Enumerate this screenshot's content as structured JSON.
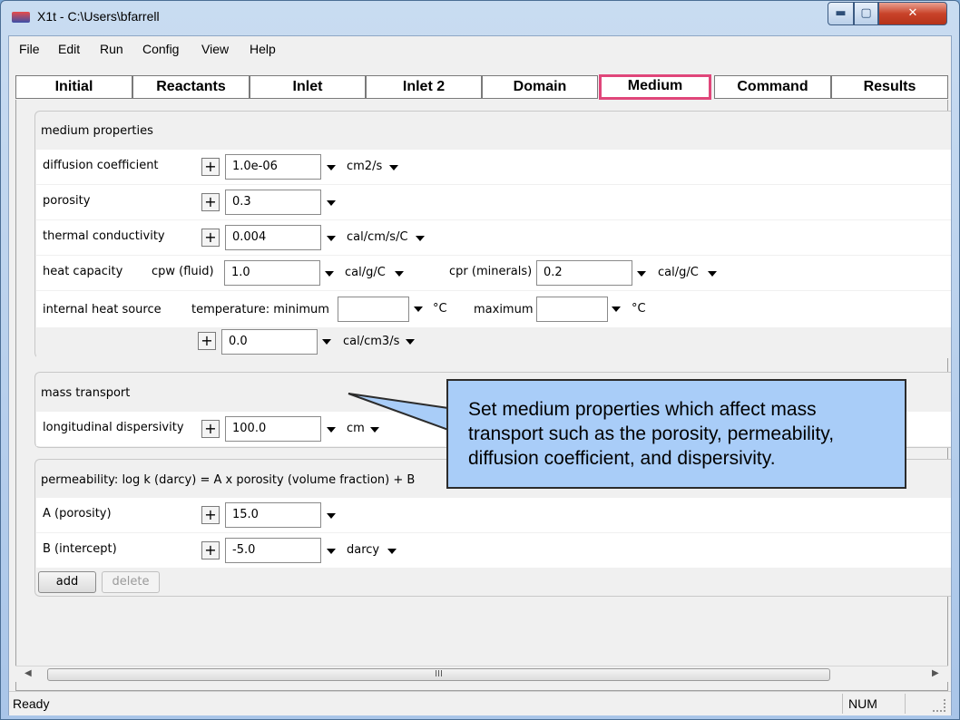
{
  "window": {
    "title": "X1t - C:\\Users\\bfarrell",
    "min_label": "▬",
    "max_label": "▢",
    "close_label": "✕"
  },
  "menu": [
    "File",
    "Edit",
    "Run",
    "Config",
    "View",
    "Help"
  ],
  "tabs": [
    "Initial",
    "Reactants",
    "Inlet",
    "Inlet 2",
    "Domain",
    "Medium",
    "Command",
    "Results"
  ],
  "active_tab": "Medium",
  "medium_properties": {
    "title": "medium properties",
    "diffusion": {
      "label": "diffusion coefficient",
      "value": "1.0e-06",
      "unit": "cm2/s"
    },
    "porosity": {
      "label": "porosity",
      "value": "0.3"
    },
    "thermal": {
      "label": "thermal conductivity",
      "value": "0.004",
      "unit": "cal/cm/s/C"
    },
    "heat_capacity": {
      "label": "heat capacity",
      "cpw_label": "cpw (fluid)",
      "cpw_value": "1.0",
      "cpw_unit": "cal/g/C",
      "cpr_label": "cpr (minerals)",
      "cpr_value": "0.2",
      "cpr_unit": "cal/g/C"
    },
    "heat_source": {
      "label": "internal heat source",
      "temp_label": "temperature:  minimum",
      "min_value": "",
      "min_unit": "°C",
      "max_label": "maximum",
      "max_value": "",
      "max_unit": "°C",
      "source_value": "0.0",
      "source_unit": "cal/cm3/s"
    }
  },
  "mass_transport": {
    "title": "mass transport",
    "dispersivity": {
      "label": "longitudinal dispersivity",
      "value": "100.0",
      "unit": "cm"
    }
  },
  "permeability": {
    "title": "permeability: log k (darcy) = A x porosity (volume fraction) + B",
    "a": {
      "label": "A (porosity)",
      "value": "15.0"
    },
    "b": {
      "label": "B (intercept)",
      "value": "-5.0",
      "unit": "darcy"
    },
    "add_label": "add",
    "delete_label": "delete"
  },
  "plus_label": "+",
  "scroll_thumb_label": "III",
  "status": {
    "left": "Ready",
    "num": "NUM"
  },
  "callout": {
    "text": "Set medium properties which affect mass transport such as the porosity, permeability, diffusion coefficient, and dispersivity."
  },
  "colors": {
    "active_tab_border": "#e0467a",
    "callout_fill": "#a9cdf8",
    "desktop": "#7aa7d6"
  }
}
